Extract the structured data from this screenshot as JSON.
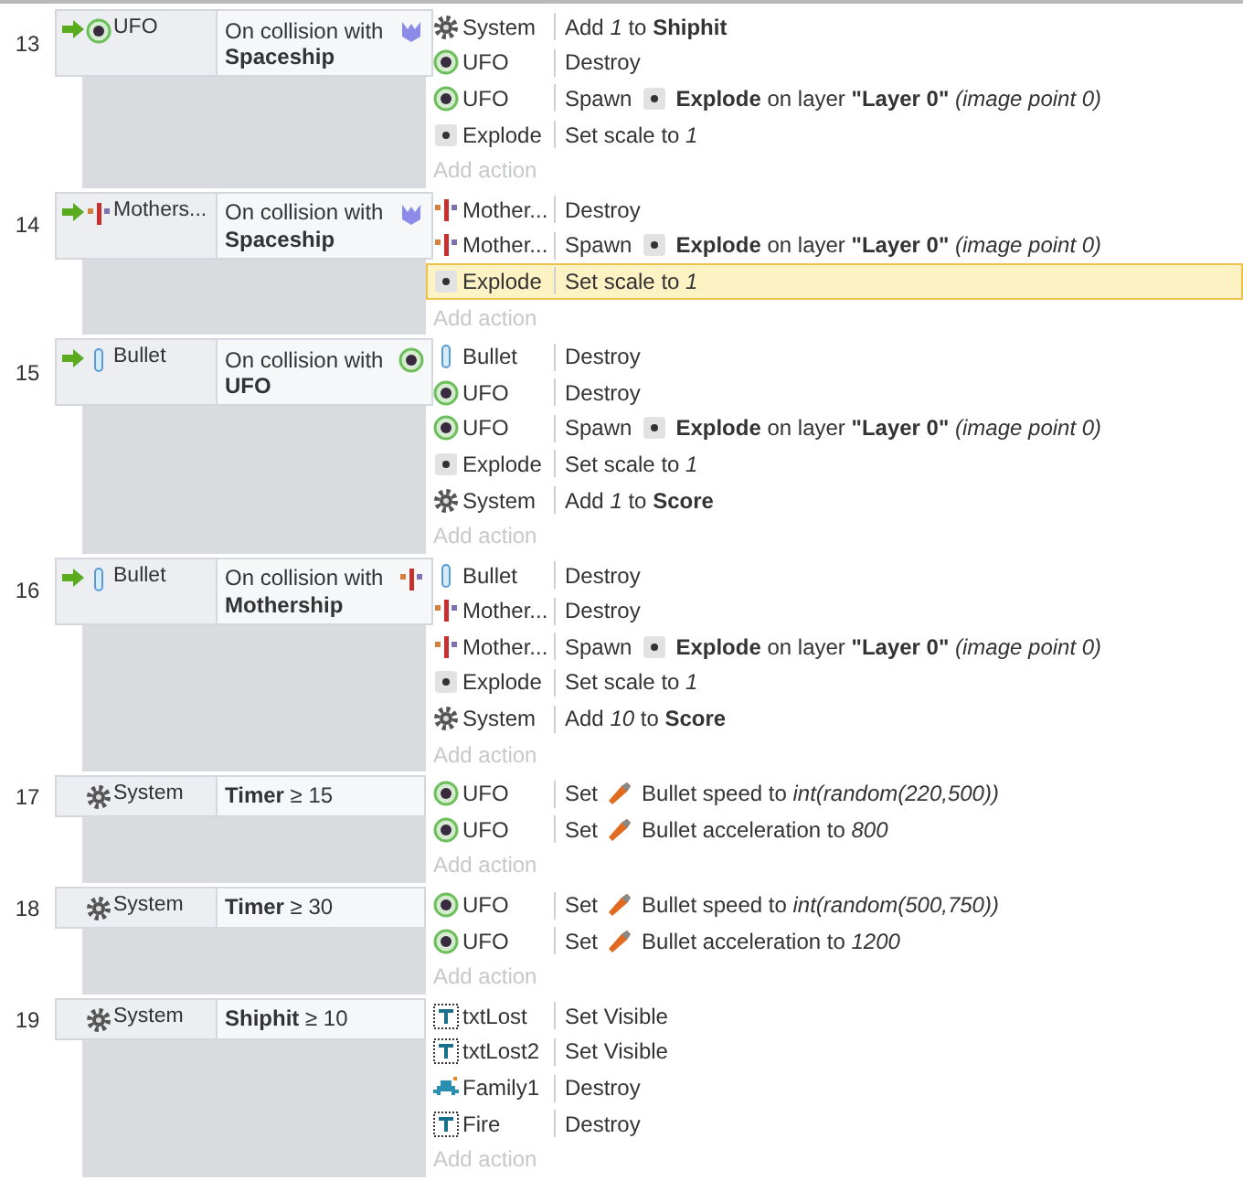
{
  "events": [
    {
      "number": "13",
      "condition": {
        "trigger": true,
        "kind": "ufo",
        "object": "UFO",
        "text": "On collision with",
        "target": {
          "kind": "spaceship",
          "name": "Spaceship"
        }
      },
      "actions": [
        {
          "kind": "system",
          "object": "System",
          "text": "Add *1* to **Shiphit**",
          "selected": false
        },
        {
          "kind": "ufo",
          "object": "UFO",
          "text": "Destroy",
          "selected": false
        },
        {
          "kind": "ufo",
          "object": "UFO",
          "prefix": "Spawn",
          "inline": {
            "kind": "explode"
          },
          "text": "**Explode** on layer **\"Layer 0\"** *(image point 0)*",
          "selected": false
        },
        {
          "kind": "explode",
          "object": "Explode",
          "text": "Set scale to *1*",
          "selected": false
        }
      ],
      "add_action": "Add action"
    },
    {
      "number": "14",
      "condition": {
        "trigger": true,
        "kind": "mothership",
        "object": "Mothers...",
        "text": "On collision with",
        "target": {
          "kind": "spaceship",
          "name": "Spaceship"
        }
      },
      "actions": [
        {
          "kind": "mothership",
          "object": "Mother...",
          "text": "Destroy",
          "selected": false
        },
        {
          "kind": "mothership",
          "object": "Mother...",
          "prefix": "Spawn",
          "inline": {
            "kind": "explode"
          },
          "text": "**Explode** on layer **\"Layer 0\"** *(image point 0)*",
          "selected": false
        },
        {
          "kind": "explode",
          "object": "Explode",
          "text": "Set scale to *1*",
          "selected": true
        }
      ],
      "add_action": "Add action"
    },
    {
      "number": "15",
      "condition": {
        "trigger": true,
        "kind": "bullet",
        "object": "Bullet",
        "text": "On collision with",
        "target": {
          "kind": "ufo",
          "name": "UFO"
        }
      },
      "actions": [
        {
          "kind": "bullet",
          "object": "Bullet",
          "text": "Destroy",
          "selected": false
        },
        {
          "kind": "ufo",
          "object": "UFO",
          "text": "Destroy",
          "selected": false
        },
        {
          "kind": "ufo",
          "object": "UFO",
          "prefix": "Spawn",
          "inline": {
            "kind": "explode"
          },
          "text": "**Explode** on layer **\"Layer 0\"** *(image point 0)*",
          "selected": false
        },
        {
          "kind": "explode",
          "object": "Explode",
          "text": "Set scale to *1*",
          "selected": false
        },
        {
          "kind": "system",
          "object": "System",
          "text": "Add *1* to **Score**",
          "selected": false
        }
      ],
      "add_action": "Add action"
    },
    {
      "number": "16",
      "condition": {
        "trigger": true,
        "kind": "bullet",
        "object": "Bullet",
        "text": "On collision with",
        "target": {
          "kind": "mothership",
          "name": "Mothership"
        }
      },
      "actions": [
        {
          "kind": "bullet",
          "object": "Bullet",
          "text": "Destroy",
          "selected": false
        },
        {
          "kind": "mothership",
          "object": "Mother...",
          "text": "Destroy",
          "selected": false
        },
        {
          "kind": "mothership",
          "object": "Mother...",
          "prefix": "Spawn",
          "inline": {
            "kind": "explode"
          },
          "text": "**Explode** on layer **\"Layer 0\"** *(image point 0)*",
          "selected": false
        },
        {
          "kind": "explode",
          "object": "Explode",
          "text": "Set scale to *1*",
          "selected": false
        },
        {
          "kind": "system",
          "object": "System",
          "text": "Add *10* to **Score**",
          "selected": false
        }
      ],
      "add_action": "Add action"
    },
    {
      "number": "17",
      "condition": {
        "trigger": false,
        "kind": "system",
        "object": "System",
        "text": "**Timer** ≥ 15"
      },
      "actions": [
        {
          "kind": "ufo",
          "object": "UFO",
          "prefix": "Set",
          "inline": {
            "kind": "behavior"
          },
          "text": "Bullet speed to *int(random(220,500))*",
          "selected": false
        },
        {
          "kind": "ufo",
          "object": "UFO",
          "prefix": "Set",
          "inline": {
            "kind": "behavior"
          },
          "text": "Bullet acceleration to *800*",
          "selected": false
        }
      ],
      "add_action": "Add action"
    },
    {
      "number": "18",
      "condition": {
        "trigger": false,
        "kind": "system",
        "object": "System",
        "text": "**Timer** ≥ 30"
      },
      "actions": [
        {
          "kind": "ufo",
          "object": "UFO",
          "prefix": "Set",
          "inline": {
            "kind": "behavior"
          },
          "text": "Bullet speed to *int(random(500,750))*",
          "selected": false
        },
        {
          "kind": "ufo",
          "object": "UFO",
          "prefix": "Set",
          "inline": {
            "kind": "behavior"
          },
          "text": "Bullet acceleration to *1200*",
          "selected": false
        }
      ],
      "add_action": "Add action"
    },
    {
      "number": "19",
      "condition": {
        "trigger": false,
        "kind": "system",
        "object": "System",
        "text": "**Shiphit** ≥ 10"
      },
      "actions": [
        {
          "kind": "text",
          "object": "txtLost",
          "text": "Set Visible",
          "selected": false
        },
        {
          "kind": "text",
          "object": "txtLost2",
          "text": "Set Visible",
          "selected": false
        },
        {
          "kind": "family",
          "object": "Family1",
          "text": "Destroy",
          "selected": false
        },
        {
          "kind": "text",
          "object": "Fire",
          "text": "Destroy",
          "selected": false
        }
      ],
      "add_action": "Add action"
    }
  ]
}
